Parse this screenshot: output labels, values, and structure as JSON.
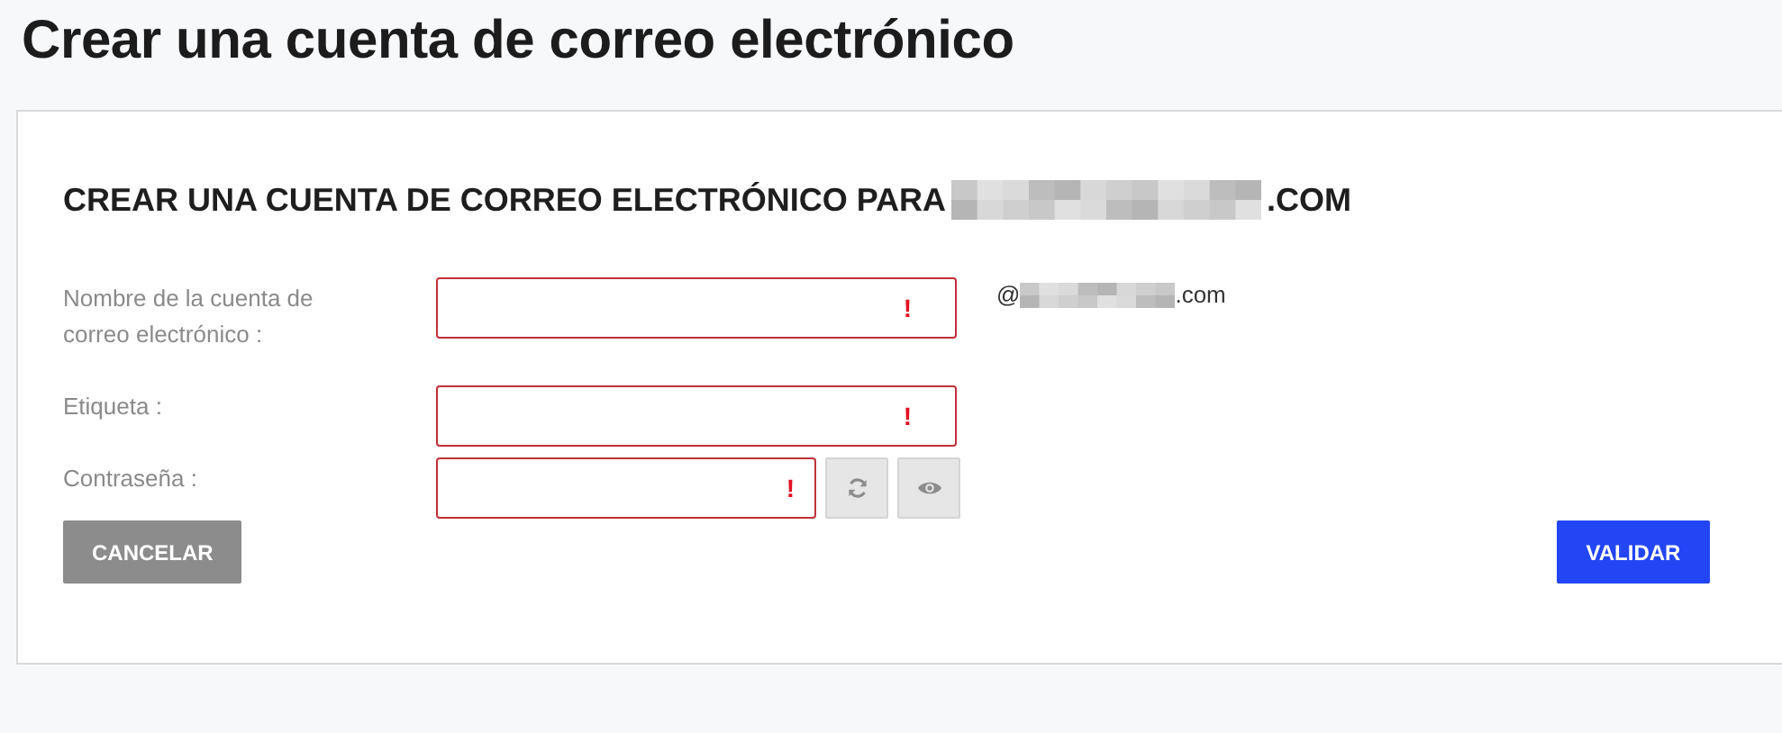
{
  "page_title": "Crear una cuenta de correo electrónico",
  "form": {
    "heading": {
      "prefix": "CREAR UNA CUENTA DE CORREO ELECTRÓNICO PARA",
      "domain_hidden": true,
      "suffix": ".COM"
    },
    "fields": [
      {
        "kind": "email",
        "label": "Nombre de la cuenta de correo electrónico :",
        "invalid": true,
        "error_mark": "!",
        "at": "@",
        "domain_hidden": true,
        "domain_suffix": ".com"
      },
      {
        "kind": "text",
        "label": "Etiqueta :",
        "invalid": true,
        "error_mark": "!"
      },
      {
        "kind": "password",
        "label": "Contraseña :",
        "invalid": true,
        "error_mark": "!"
      }
    ],
    "buttons": [
      {
        "label": "CANCELAR",
        "kind": "secondary"
      },
      {
        "label": "VALIDAR",
        "kind": "primary"
      }
    ]
  }
}
